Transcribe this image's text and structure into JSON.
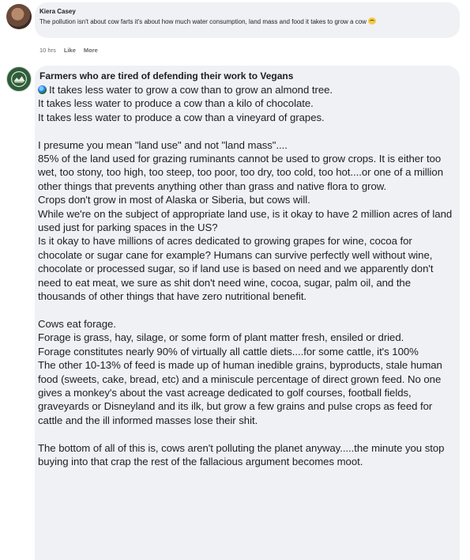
{
  "comment1": {
    "author": "Kiera Casey",
    "text": "The pollution isn't about cow farts it's about how much water consumption, land mass and food it takes to grow a cow",
    "time": "10 hrs",
    "like_label": "Like",
    "more_label": "More",
    "emoji_icon": "hear-no-evil-monkey-icon"
  },
  "comment2": {
    "author": "Farmers who are tired of defending their work to Vegans",
    "globe_icon": "globe-icon",
    "paragraphs": [
      "It takes less water to grow a cow than to grow an almond tree.\nIt takes less water to produce a cow than a kilo of chocolate.\nIt takes less water to produce a cow than a vineyard of grapes.",
      "I presume you mean \"land use\" and not \"land mass\"....\n85% of the land used for grazing ruminants cannot be used to grow crops. It is either too wet, too stony, too high, too steep, too poor, too dry, too cold, too hot....or one of a million other things that prevents anything other than grass and native flora to grow.\nCrops don't grow in most of Alaska or Siberia, but cows will.\nWhile we're on the subject of appropriate land use, is it okay to have 2 million acres of land used just for parking spaces in the US?\nIs it okay to have millions of acres dedicated to growing grapes for wine, cocoa for chocolate or sugar cane for example? Humans can survive perfectly well without wine, chocolate or processed sugar, so if land use is based on need and we apparently don't need to eat meat, we sure as shit don't need wine, cocoa, sugar, palm oil, and the thousands of other things that have zero nutritional benefit.",
      "Cows eat forage.\nForage is grass, hay, silage, or some form of plant matter fresh, ensiled or dried.\nForage constitutes nearly 90% of virtually all cattle diets....for some cattle, it's 100%\nThe other 10-13% of feed is made up of human inedible grains, byproducts, stale human food (sweets, cake, bread, etc) and a miniscule percentage of direct grown feed. No one gives a monkey's about the vast acreage dedicated to golf courses, football fields, graveyards or Disneyland and its ilk, but grow a few grains and pulse crops as feed for cattle and the ill informed masses lose their shit.",
      "The bottom of all of this is, cows aren't polluting the planet anyway.....the minute you stop buying into that crap the rest of the fallacious argument becomes moot."
    ]
  }
}
